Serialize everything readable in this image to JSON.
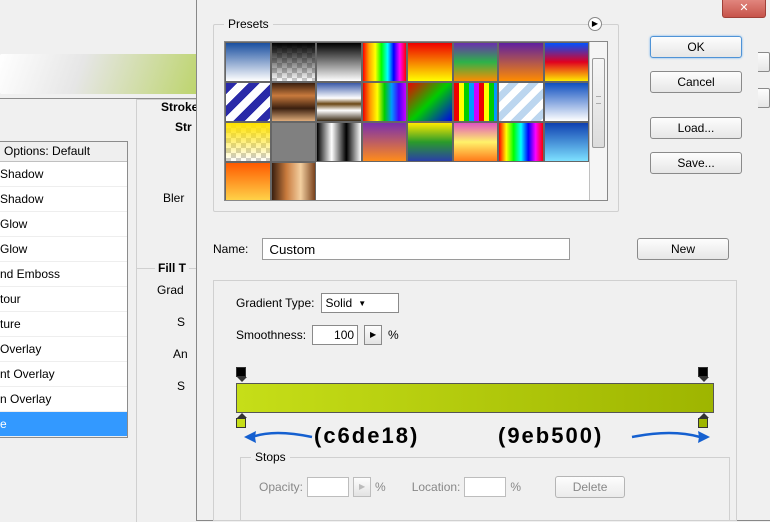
{
  "layer_dialog": {
    "options_label": "Options: Default",
    "stroke_legend": "Stroke",
    "stroke_sublegend": "Str",
    "rows": [
      "Bler",
      "Grad",
      "S",
      "An",
      "S"
    ],
    "fill_legend": "Fill T",
    "fx_items": [
      "Shadow",
      "Shadow",
      "Glow",
      "Glow",
      "nd Emboss",
      "tour",
      "ture",
      "Overlay",
      "nt Overlay",
      "n Overlay",
      "e"
    ],
    "active_index": 10
  },
  "gradient_dialog": {
    "presets_label": "Presets",
    "buttons": {
      "ok": "OK",
      "cancel": "Cancel",
      "load": "Load...",
      "save": "Save...",
      "new": "New",
      "delete": "Delete"
    },
    "name_label": "Name:",
    "name_value": "Custom",
    "gradient_type_label": "Gradient Type:",
    "gradient_type_value": "Solid",
    "smoothness_label": "Smoothness:",
    "smoothness_value": "100",
    "percent": "%",
    "stops_label": "Stops",
    "opacity_label": "Opacity:",
    "location_label": "Location:",
    "annotations": {
      "left": "(c6de18)",
      "right": "(9eb500)"
    },
    "gradient_stops": {
      "left_color": "#c6de18",
      "right_color": "#9eb500"
    }
  }
}
